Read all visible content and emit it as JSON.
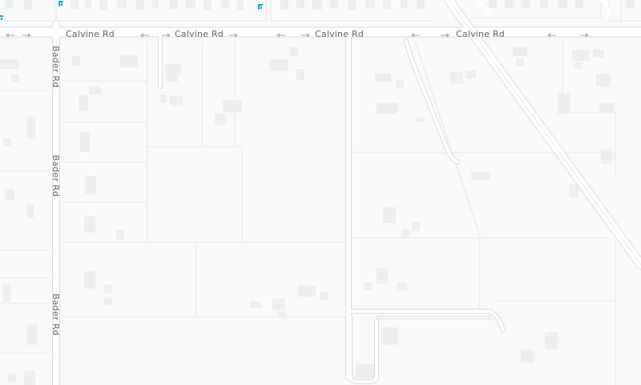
{
  "map": {
    "colors": {
      "land": "#f8f9fa",
      "road": "#ffffff",
      "road_edge": "#dadce0",
      "parcel_line": "#e3e5e8",
      "building": "#eceef0",
      "label": "#5f6368",
      "arrow": "#b0b4b8",
      "transit": "#1a9bd7"
    },
    "streets": {
      "calvine_1": "Calvine Rd",
      "calvine_2": "Calvine Rd",
      "calvine_3": "Calvine Rd",
      "calvine_4": "Calvine Rd",
      "bader_1": "Bader Rd",
      "bader_2": "Bader Rd",
      "bader_3": "Bader Rd"
    },
    "icons": {
      "transit_stop": "bus-stop-icon",
      "one_way_arrow": "one-way-arrow-icon"
    }
  }
}
